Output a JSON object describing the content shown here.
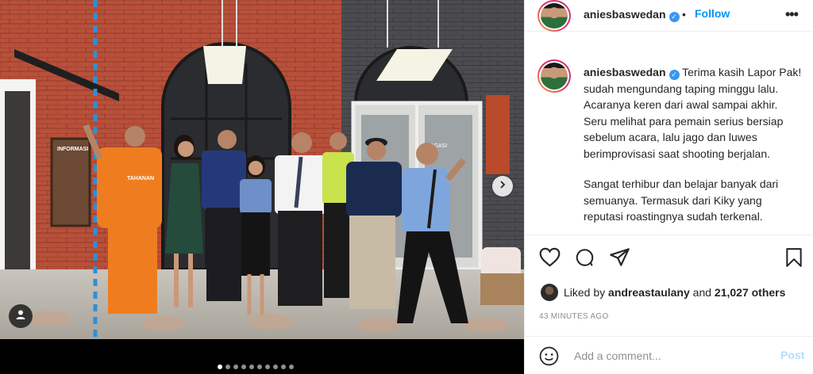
{
  "post": {
    "username": "aniesbaswedan",
    "separator": "•",
    "follow_label": "Follow",
    "more_label": "•••",
    "verified_glyph": "✓"
  },
  "caption": {
    "username": "aniesbaswedan",
    "paragraph1": "Terima kasih Lapor Pak! sudah mengundang taping minggu lalu. Acaranya keren dari awal sampai akhir. Seru melihat para pemain serius bersiap sebelum acara, lalu jago dan luwes berimprovisasi saat shooting berjalan.",
    "paragraph2": "Sangat terhibur dan belajar banyak dari semuanya. Termasuk dari Kiky yang reputasi roastingnya sudah terkenal."
  },
  "likes": {
    "prefix": "Liked by",
    "user": "andreastaulany",
    "conjunction": "and",
    "others": "21,027 others"
  },
  "timestamp": "43 MINUTES AGO",
  "comment": {
    "placeholder": "Add a comment...",
    "post_label": "Post"
  },
  "carousel": {
    "slide_count": 10,
    "active_index": 0
  },
  "photo": {
    "sign_text": "INFORMASI",
    "shirt_text": "TAHANAN",
    "door_text": "DOGASI"
  },
  "icons": {
    "like": "heart-icon",
    "comment": "comment-icon",
    "share": "share-icon",
    "save": "bookmark-icon",
    "emoji": "emoji-icon",
    "user_tag": "user-tag-icon",
    "next": "chevron-right-icon"
  },
  "colors": {
    "link_blue": "#0095f6",
    "post_disabled": "#b2dffc",
    "verified": "#3897f0",
    "muted": "#8e8e8e"
  }
}
